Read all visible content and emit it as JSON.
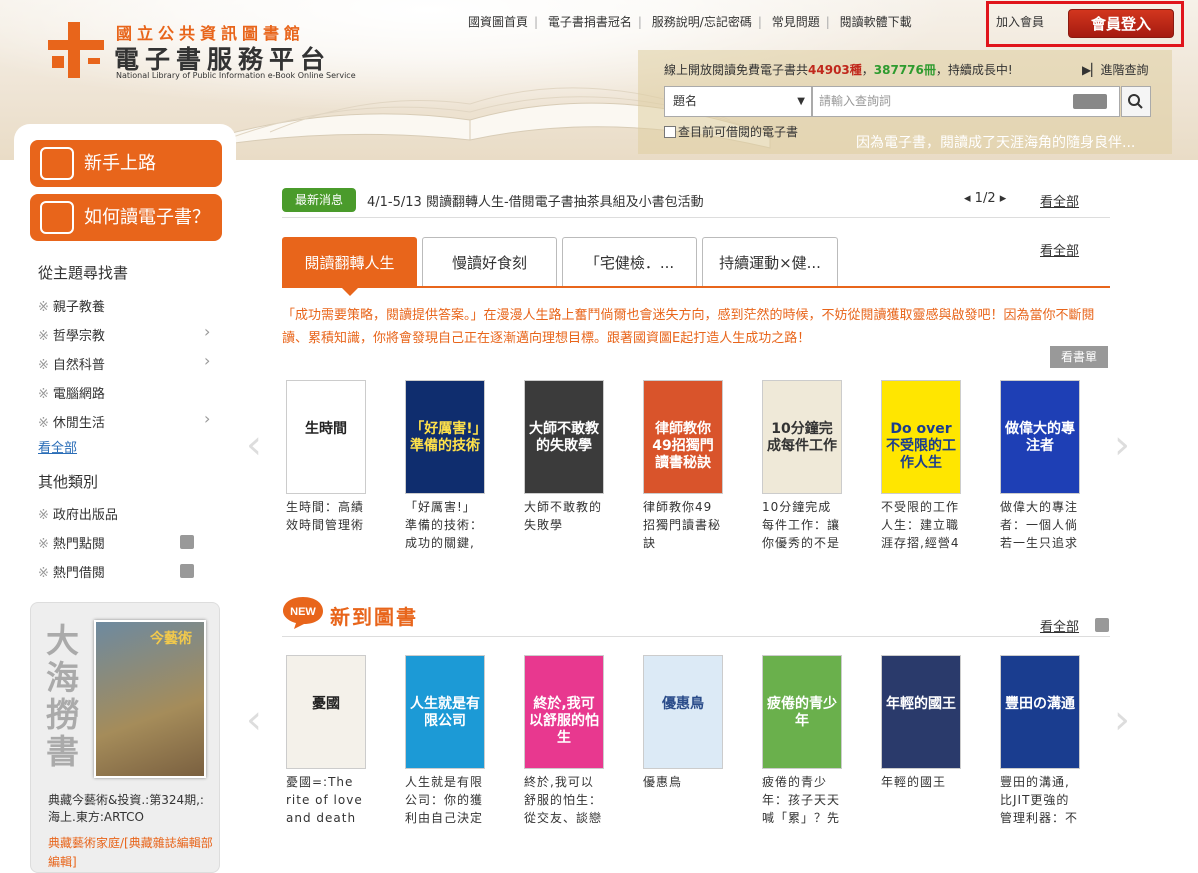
{
  "header": {
    "logo_title_1": "國立公共資訊圖書館",
    "logo_title_2": "電子書服務平台",
    "logo_sub": "National Library of Public Information e-Book Online Service",
    "nav": [
      "國資圖首頁",
      "電子書捐書冠名",
      "服務說明/忘記密碼",
      "常見問題",
      "閱讀軟體下載"
    ],
    "join": "加入會員",
    "login": "會員登入",
    "stats_prefix": "線上開放閱讀免費電子書共",
    "stats_titles": "44903種",
    "stats_sep": "，",
    "stats_volumes": "387776冊",
    "stats_suffix": "，持續成長中!",
    "advanced_search": "進階查詢",
    "search_select": "題名",
    "search_placeholder": "請輸入查詢詞",
    "available_checkbox": "查目前可借閱的電子書",
    "slogan": "因為電子書，閱讀成了天涯海角的隨身良伴..."
  },
  "sidebar": {
    "btn_newbie": "新手上路",
    "btn_howto": "如何讀電子書？",
    "topic_heading": "從主題尋找書",
    "topics": [
      "親子教養",
      "哲學宗教",
      "自然科普",
      "電腦網路",
      "休閒生活"
    ],
    "topics_all": "看全部",
    "other_heading": "其他類別",
    "others": [
      "政府出版品",
      "熱門點閱",
      "熱門借閱"
    ],
    "mag_heading": "大海撈書",
    "mag_cover_title": "今藝術",
    "mag_desc": "典藏今藝術&投資.:第324期,:海上.東方:ARTCO",
    "mag_publisher": "典藏藝術家庭/[典藏雜誌編輯部編輯]"
  },
  "news": {
    "tag": "最新消息",
    "text": "4/1-5/13 閱讀翻轉人生-借閱電子書抽茶具組及小書包活動",
    "pager": "1/2",
    "all": "看全部"
  },
  "tabs": {
    "items": [
      "閱讀翻轉人生",
      "慢讀好食刻",
      "「宅健檢．...",
      "持續運動×健..."
    ],
    "all": "看全部",
    "desc": "「成功需要策略，閱讀提供答案。」在漫漫人生路上奮鬥倘爾也會迷失方向，感到茫然的時候，不妨從閱讀獲取靈感與啟發吧！因為當你不斷閱讀、累積知識，你將會發現自己正在逐漸邁向理想目標。跟著國資圖E起打造人生成功之路！",
    "booklist": "看書單"
  },
  "featured_books": [
    {
      "cover": "生時間",
      "title": "生時間：高績效時間管理術",
      "bg": "#ffffff",
      "fg": "#222222"
    },
    {
      "cover": "「好厲害!」準備的技術",
      "title": "「好厲害!」準備的技術：成功的關鍵,",
      "bg": "#0f2d6e",
      "fg": "#ffe14a"
    },
    {
      "cover": "大師不敢教的失敗學",
      "title": "大師不敢教的失敗學",
      "bg": "#3b3b3b",
      "fg": "#ffffff"
    },
    {
      "cover": "律師教你49招獨門讀書秘訣",
      "title": "律師教你49招獨門讀書秘訣",
      "bg": "#d9542b",
      "fg": "#ffffff"
    },
    {
      "cover": "10分鐘完成每件工作",
      "title": "10分鐘完成每件工作：讓你優秀的不是",
      "bg": "#efe9d8",
      "fg": "#333333"
    },
    {
      "cover": "Do over 不受限的工作人生",
      "title": "不受限的工作人生：建立職涯存摺,經營4",
      "bg": "#ffe600",
      "fg": "#1a3d8f"
    },
    {
      "cover": "做偉大的專注者",
      "title": "做偉大的專注者：一個人倘若一生只追求",
      "bg": "#1e3fb5",
      "fg": "#ffffff"
    }
  ],
  "new_arrivals": {
    "badge": "NEW",
    "title": "新到圖書",
    "all": "看全部",
    "books": [
      {
        "cover": "憂國",
        "title": "憂國=:The rite of love and death",
        "bg": "#f4f1ea",
        "fg": "#222222"
      },
      {
        "cover": "人生就是有限公司",
        "title": "人生就是有限公司：你的獲利由自己決定",
        "bg": "#1c9ad6",
        "fg": "#ffffff"
      },
      {
        "cover": "終於,我可以舒服的怕生",
        "title": "終於,我可以舒服的怕生：從交友、談戀",
        "bg": "#e8388f",
        "fg": "#ffffff"
      },
      {
        "cover": "優惠鳥",
        "title": "優惠鳥",
        "bg": "#dceaf6",
        "fg": "#2a4c8a"
      },
      {
        "cover": "疲倦的青少年",
        "title": "疲倦的青少年：孩子天天喊「累」？先別",
        "bg": "#6ab04c",
        "fg": "#ffffff"
      },
      {
        "cover": "年輕的國王",
        "title": "年輕的國王",
        "bg": "#2a3a6b",
        "fg": "#ffffff"
      },
      {
        "cover": "豐田の溝通",
        "title": "豐田的溝通,比JIT更強的管理利器：不",
        "bg": "#1a3d8f",
        "fg": "#ffffff"
      }
    ]
  },
  "colors": {
    "accent": "#e8651b",
    "news_green": "#4a9b2b",
    "login_red": "#c0281c",
    "highlight": "#e0141b"
  }
}
